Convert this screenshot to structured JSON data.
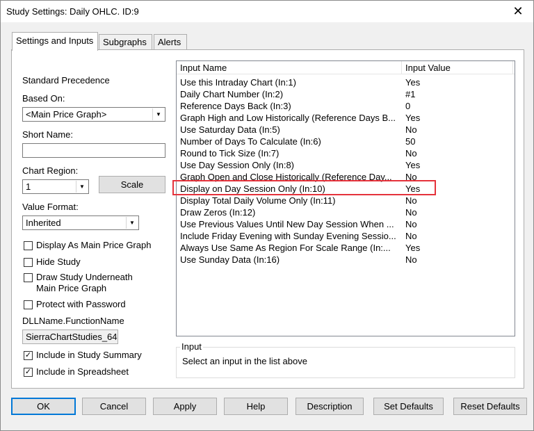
{
  "window": {
    "title": "Study Settings: Daily OHLC. ID:9",
    "close_glyph": "✕"
  },
  "tabs": [
    {
      "label": "Settings and Inputs"
    },
    {
      "label": "Subgraphs"
    },
    {
      "label": "Alerts"
    }
  ],
  "settings": {
    "standard_precedence": "Standard Precedence",
    "based_on_label": "Based On:",
    "based_on_value": "<Main Price Graph>",
    "short_name_label": "Short Name:",
    "short_name_value": "",
    "chart_region_label": "Chart Region:",
    "chart_region_value": "1",
    "scale_button": "Scale",
    "value_format_label": "Value Format:",
    "value_format_value": "Inherited",
    "checkboxes": [
      {
        "label": "Display As Main Price Graph",
        "checked": false
      },
      {
        "label": "Hide Study",
        "checked": false
      },
      {
        "label": "Draw Study Underneath Main Price Graph",
        "checked": false
      },
      {
        "label": "Protect with Password",
        "checked": false
      }
    ],
    "dll_label": "DLLName.FunctionName",
    "dll_value": "SierraChartStudies_64",
    "include_summary": {
      "label": "Include in Study Summary",
      "checked": true
    },
    "include_spreadsheet": {
      "label": "Include in Spreadsheet",
      "checked": true
    }
  },
  "inputs_table": {
    "columns": [
      "Input Name",
      "Input Value"
    ],
    "rows": [
      {
        "name": "Use this Intraday Chart  (In:1)",
        "value": "Yes"
      },
      {
        "name": "Daily Chart Number  (In:2)",
        "value": "#1"
      },
      {
        "name": "Reference Days Back  (In:3)",
        "value": "0"
      },
      {
        "name": "Graph High and Low Historically (Reference Days B...",
        "value": "Yes"
      },
      {
        "name": "Use Saturday Data  (In:5)",
        "value": "No"
      },
      {
        "name": "Number of Days To Calculate  (In:6)",
        "value": "50"
      },
      {
        "name": "Round to Tick Size  (In:7)",
        "value": "No"
      },
      {
        "name": "Use Day Session Only  (In:8)",
        "value": "Yes"
      },
      {
        "name": "Graph Open and Close Historically (Reference Day...",
        "value": "No"
      },
      {
        "name": "Display on Day Session Only  (In:10)",
        "value": "Yes"
      },
      {
        "name": "Display Total Daily Volume Only  (In:11)",
        "value": "No"
      },
      {
        "name": "Draw Zeros  (In:12)",
        "value": "No"
      },
      {
        "name": "Use Previous Values Until New Day Session When ...",
        "value": "No"
      },
      {
        "name": "Include Friday Evening with Sunday Evening Sessio...",
        "value": "No"
      },
      {
        "name": "Always Use Same As Region For Scale Range  (In:...",
        "value": "Yes"
      },
      {
        "name": "Use Sunday Data  (In:16)",
        "value": "No"
      }
    ],
    "highlighted_row": 9,
    "highlight_color": "#e5323b"
  },
  "input_group": {
    "title": "Input",
    "text": "Select an input in the list above"
  },
  "buttons": {
    "ok": "OK",
    "cancel": "Cancel",
    "apply": "Apply",
    "help": "Help",
    "description": "Description",
    "set_defaults": "Set Defaults",
    "reset_defaults": "Reset Defaults"
  },
  "accent_color": "#0078d7"
}
